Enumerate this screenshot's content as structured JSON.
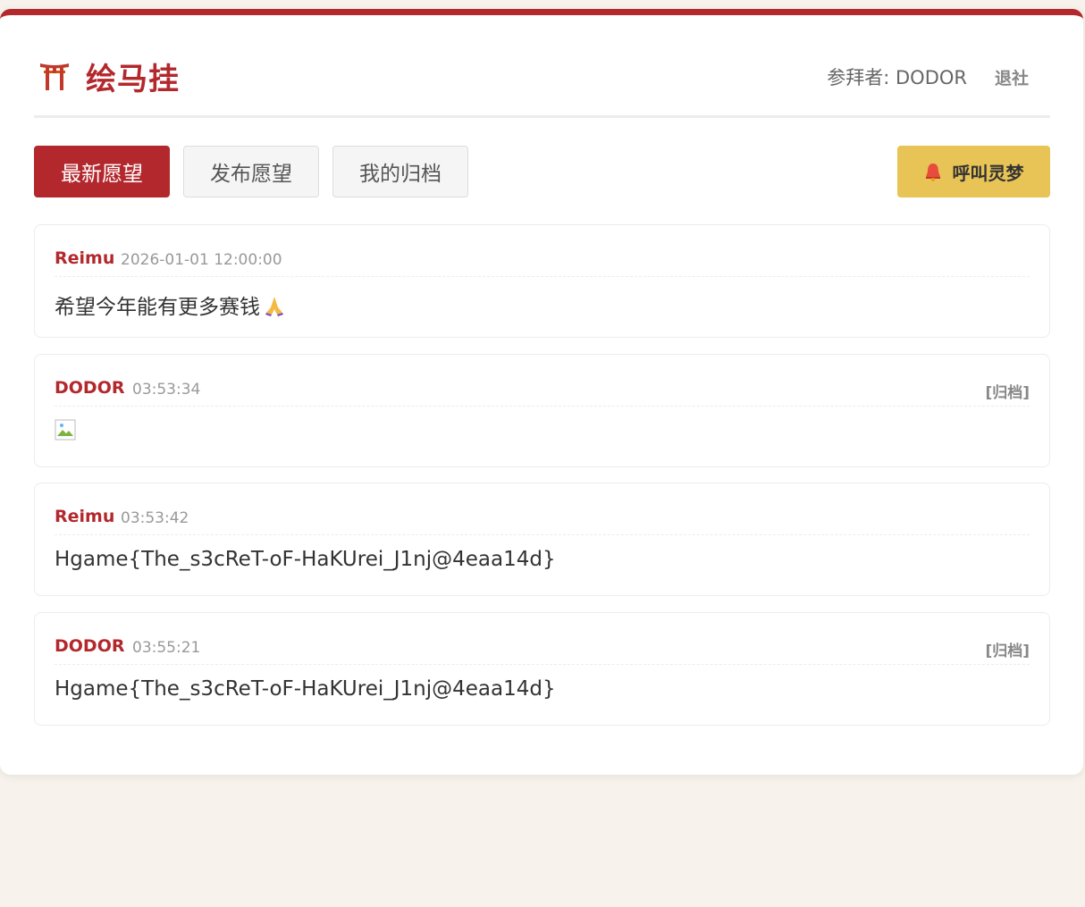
{
  "header": {
    "title": "绘马挂",
    "user_label": "参拜者: DODOR",
    "logout_label": "退社"
  },
  "tabs": [
    {
      "label": "最新愿望",
      "active": true
    },
    {
      "label": "发布愿望",
      "active": false
    },
    {
      "label": "我的归档",
      "active": false
    }
  ],
  "call_button": {
    "label": "呼叫灵梦",
    "icon": "bell-icon"
  },
  "posts": [
    {
      "author": "Reimu",
      "time": "2026-01-01 12:00:00",
      "content": "希望今年能有更多赛钱",
      "emoji": "praying-hands-icon",
      "archive": ""
    },
    {
      "author": "DODOR",
      "time": "03:53:34",
      "content": "",
      "image": "broken-image-icon",
      "archive": "[归档]"
    },
    {
      "author": "Reimu",
      "time": "03:53:42",
      "content": "Hgame{The_s3cReT-oF-HaKUrei_J1nj@4eaa14d}",
      "archive": ""
    },
    {
      "author": "DODOR",
      "time": "03:55:21",
      "content": "Hgame{The_s3cReT-oF-HaKUrei_J1nj@4eaa14d}",
      "archive": "[归档]"
    }
  ],
  "colors": {
    "accent": "#b3282d",
    "call_button": "#e8c356",
    "background": "#f7f3ec"
  }
}
